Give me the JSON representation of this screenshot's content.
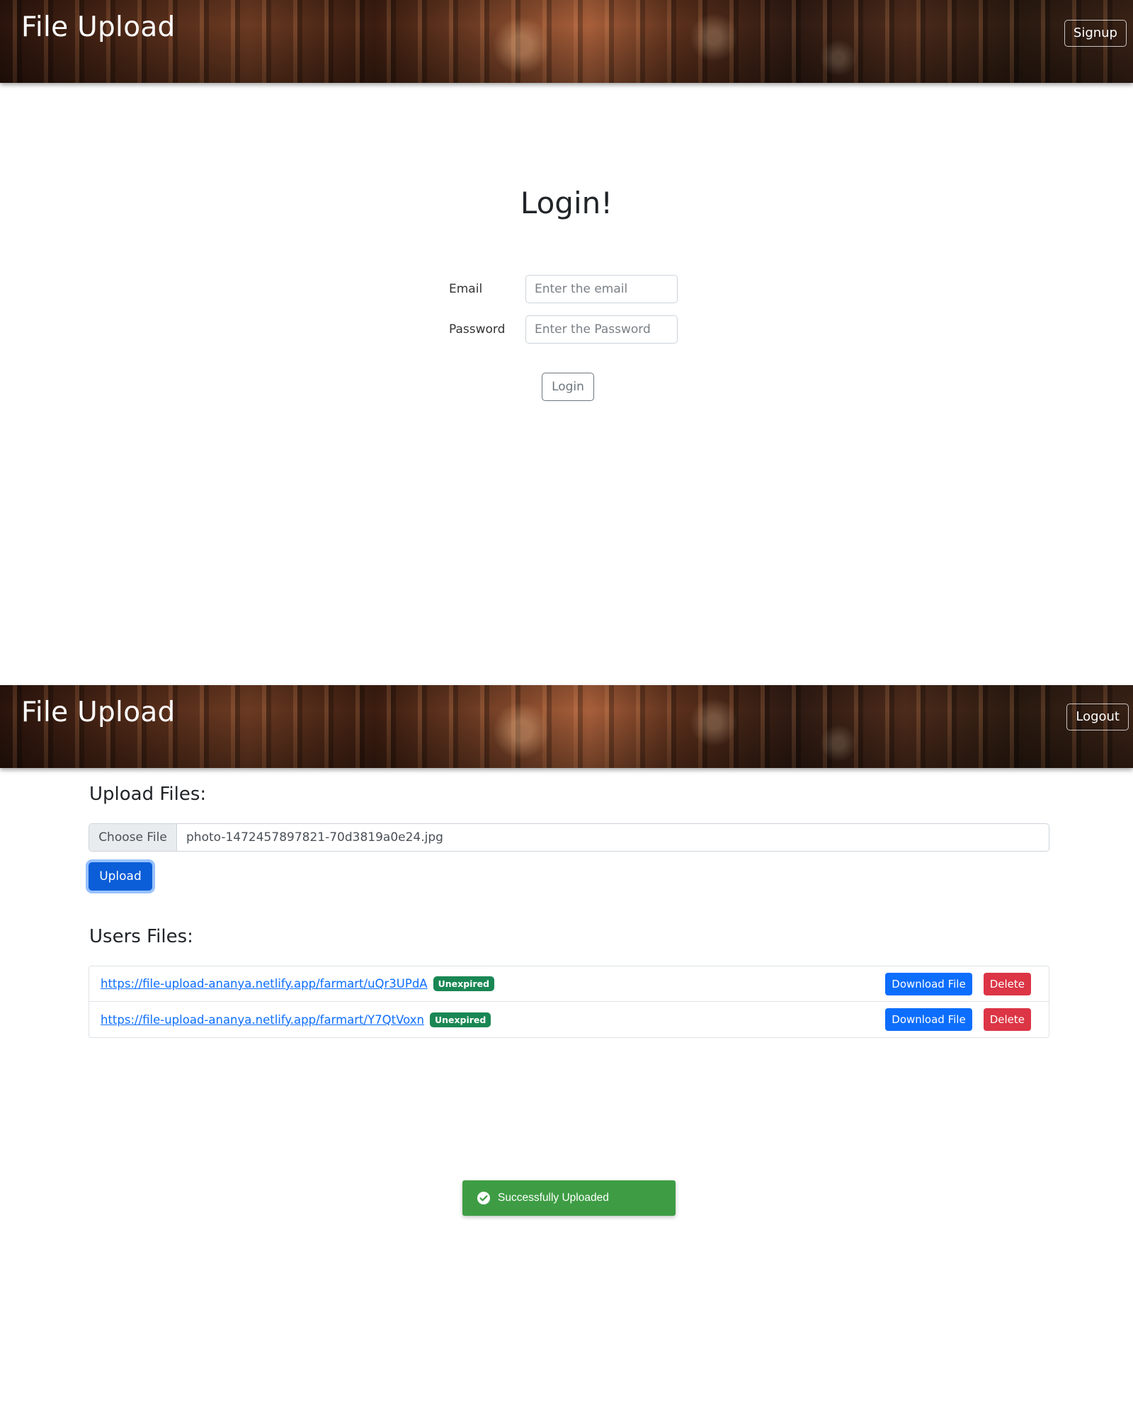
{
  "login_screen": {
    "header": {
      "brand": "File Upload",
      "signup_label": "Signup"
    },
    "title": "Login!",
    "email": {
      "label": "Email",
      "placeholder": "Enter the email"
    },
    "password": {
      "label": "Password",
      "placeholder": "Enter the Password"
    },
    "login_label": "Login"
  },
  "files_screen": {
    "header": {
      "brand": "File Upload",
      "logout_label": "Logout"
    },
    "upload_title": "Upload Files:",
    "file_input": {
      "choose_label": "Choose File",
      "file_name": "photo-1472457897821-70d3819a0e24.jpg"
    },
    "upload_label": "Upload",
    "users_title": "Users Files:",
    "files": [
      {
        "url": "https://file-upload-ananya.netlify.app/farmart/uQr3UPdA",
        "status": "Unexpired",
        "download_label": "Download File",
        "delete_label": "Delete"
      },
      {
        "url": "https://file-upload-ananya.netlify.app/farmart/Y7QtVoxn",
        "status": "Unexpired",
        "download_label": "Download File",
        "delete_label": "Delete"
      }
    ],
    "toast": {
      "message": "Successfully Uploaded",
      "icon": "check-circle-icon"
    }
  },
  "colors": {
    "primary": "#0d6efd",
    "danger": "#dc3545",
    "success_badge": "#198754",
    "toast_bg": "#3e9d44"
  }
}
